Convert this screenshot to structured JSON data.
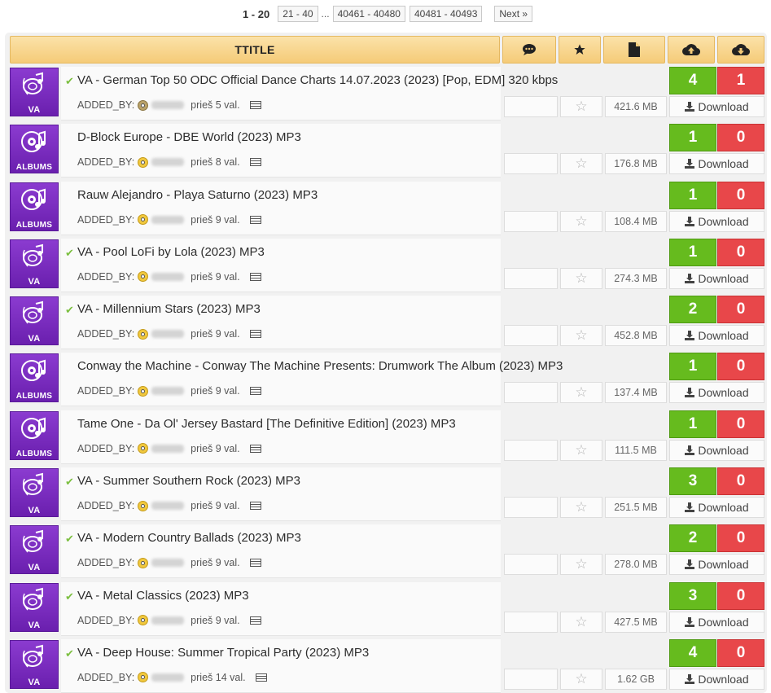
{
  "pagination": {
    "current": "1 - 20",
    "pages": [
      "21 - 40",
      "40461 - 40480",
      "40481 - 40493"
    ],
    "ellipsis": "...",
    "next": "Next »"
  },
  "header": {
    "title": "TTITLE",
    "icons": [
      "comments-icon",
      "star-icon",
      "file-icon",
      "cloud-upload-icon",
      "cloud-download-icon"
    ]
  },
  "colors": {
    "seeders": "#66bb1e",
    "leechers": "#e8474a",
    "header": "#f5cb78",
    "category": "#7a2bc0"
  },
  "rows": [
    {
      "cat": "VA",
      "checked": true,
      "title": "VA - German Top 50 ODC Official Dance Charts 14.07.2023 (2023) [Pop, EDM] 320 kbps",
      "added_by": "ADDED_BY:",
      "ago": "prieš 5 val.",
      "size": "421.6 MB",
      "seeders": "4",
      "leechers": "1",
      "download": "Download"
    },
    {
      "cat": "ALBUMS",
      "checked": false,
      "title": "D-Block Europe - DBE World (2023) MP3",
      "added_by": "ADDED_BY:",
      "ago": "prieš 8 val.",
      "size": "176.8 MB",
      "seeders": "1",
      "leechers": "0",
      "download": "Download"
    },
    {
      "cat": "ALBUMS",
      "checked": false,
      "title": "Rauw Alejandro - Playa Saturno (2023) MP3",
      "added_by": "ADDED_BY:",
      "ago": "prieš 9 val.",
      "size": "108.4 MB",
      "seeders": "1",
      "leechers": "0",
      "download": "Download"
    },
    {
      "cat": "VA",
      "checked": true,
      "title": "VA - Pool LoFi by Lola (2023) MP3",
      "added_by": "ADDED_BY:",
      "ago": "prieš 9 val.",
      "size": "274.3 MB",
      "seeders": "1",
      "leechers": "0",
      "download": "Download"
    },
    {
      "cat": "VA",
      "checked": true,
      "title": "VA - Millennium Stars (2023) MP3",
      "added_by": "ADDED_BY:",
      "ago": "prieš 9 val.",
      "size": "452.8 MB",
      "seeders": "2",
      "leechers": "0",
      "download": "Download"
    },
    {
      "cat": "ALBUMS",
      "checked": false,
      "title": "Conway the Machine - Conway The Machine Presents: Drumwork The Album (2023) MP3",
      "added_by": "ADDED_BY:",
      "ago": "prieš 9 val.",
      "size": "137.4 MB",
      "seeders": "1",
      "leechers": "0",
      "download": "Download"
    },
    {
      "cat": "ALBUMS",
      "checked": false,
      "title": "Tame One - Da Ol' Jersey Bastard [The Definitive Edition] (2023) MP3",
      "added_by": "ADDED_BY:",
      "ago": "prieš 9 val.",
      "size": "111.5 MB",
      "seeders": "1",
      "leechers": "0",
      "download": "Download"
    },
    {
      "cat": "VA",
      "checked": true,
      "title": "VA - Summer Southern Rock (2023) MP3",
      "added_by": "ADDED_BY:",
      "ago": "prieš 9 val.",
      "size": "251.5 MB",
      "seeders": "3",
      "leechers": "0",
      "download": "Download"
    },
    {
      "cat": "VA",
      "checked": true,
      "title": "VA - Modern Country Ballads (2023) MP3",
      "added_by": "ADDED_BY:",
      "ago": "prieš 9 val.",
      "size": "278.0 MB",
      "seeders": "2",
      "leechers": "0",
      "download": "Download"
    },
    {
      "cat": "VA",
      "checked": true,
      "title": "VA - Metal Classics (2023) MP3",
      "added_by": "ADDED_BY:",
      "ago": "prieš 9 val.",
      "size": "427.5 MB",
      "seeders": "3",
      "leechers": "0",
      "download": "Download"
    },
    {
      "cat": "VA",
      "checked": true,
      "title": "VA - Deep House: Summer Tropical Party (2023) MP3",
      "added_by": "ADDED_BY:",
      "ago": "prieš 14 val.",
      "size": "1.62 GB",
      "seeders": "4",
      "leechers": "0",
      "download": "Download"
    }
  ]
}
